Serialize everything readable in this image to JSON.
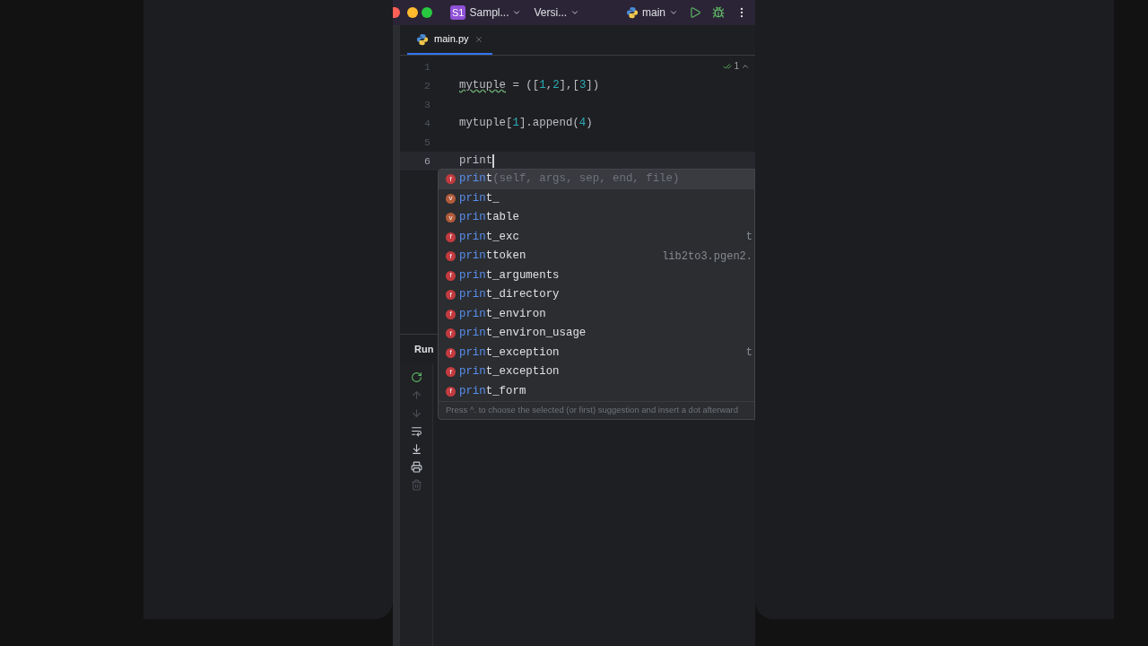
{
  "title_bar": {
    "project_badge": "S1",
    "project": "Sampl...",
    "vcs": "Versi...",
    "run_config": "main"
  },
  "tabs": [
    {
      "label": "main.py",
      "selected": true
    }
  ],
  "inspection": {
    "count": "1"
  },
  "editor": {
    "lines": [
      {
        "number": "1",
        "current": false,
        "caret": false
      },
      {
        "number": "2",
        "current": false,
        "caret": false,
        "tokens": [
          {
            "text": "mytuple",
            "kind": "warn"
          },
          {
            "text": " = ([",
            "kind": "plain"
          },
          {
            "text": "1",
            "kind": "number"
          },
          {
            "text": ",",
            "kind": "plain"
          },
          {
            "text": "2",
            "kind": "number"
          },
          {
            "text": "],[",
            "kind": "plain"
          },
          {
            "text": "3",
            "kind": "number"
          },
          {
            "text": "])",
            "kind": "plain"
          }
        ]
      },
      {
        "number": "3",
        "current": false,
        "caret": false
      },
      {
        "number": "4",
        "current": false,
        "caret": false,
        "tokens": [
          {
            "text": "mytuple[",
            "kind": "plain"
          },
          {
            "text": "1",
            "kind": "number"
          },
          {
            "text": "].append(",
            "kind": "plain"
          },
          {
            "text": "4",
            "kind": "number"
          },
          {
            "text": ")",
            "kind": "plain"
          }
        ]
      },
      {
        "number": "5",
        "current": false,
        "caret": false
      },
      {
        "number": "6",
        "current": true,
        "caret": true,
        "tokens": [
          {
            "text": "print",
            "kind": "plain"
          }
        ]
      }
    ]
  },
  "completion": {
    "items": [
      {
        "badge": "f",
        "kind": "function",
        "match": "prin",
        "rest": "t",
        "params": "(self, args, sep, end, file)",
        "selected": true
      },
      {
        "badge": "v",
        "kind": "variable",
        "match": "prin",
        "rest": "t_",
        "selected": false
      },
      {
        "badge": "v",
        "kind": "variable",
        "match": "prin",
        "rest": "table",
        "selected": false
      },
      {
        "badge": "f",
        "kind": "function",
        "match": "prin",
        "rest": "t_exc",
        "detail": "t",
        "selected": false
      },
      {
        "badge": "f",
        "kind": "function",
        "match": "prin",
        "rest": "ttoken",
        "detail": "lib2to3.pgen2.",
        "selected": false
      },
      {
        "badge": "f",
        "kind": "function",
        "match": "prin",
        "rest": "t_arguments",
        "selected": false
      },
      {
        "badge": "f",
        "kind": "function",
        "match": "prin",
        "rest": "t_directory",
        "selected": false
      },
      {
        "badge": "f",
        "kind": "function",
        "match": "prin",
        "rest": "t_environ",
        "selected": false
      },
      {
        "badge": "f",
        "kind": "function",
        "match": "prin",
        "rest": "t_environ_usage",
        "selected": false
      },
      {
        "badge": "f",
        "kind": "function",
        "match": "prin",
        "rest": "t_exception",
        "detail": "t",
        "selected": false
      },
      {
        "badge": "f",
        "kind": "function",
        "match": "prin",
        "rest": "t_exception",
        "selected": false
      },
      {
        "badge": "f",
        "kind": "function",
        "match": "prin",
        "rest": "t_form",
        "selected": false
      }
    ],
    "hint": "Press ^. to choose the selected (or first) suggestion and insert a dot afterward"
  },
  "run_panel": {
    "title": "Run",
    "tools": [
      {
        "kind": "rerun",
        "disabled": false
      },
      {
        "kind": "up",
        "disabled": true
      },
      {
        "kind": "down",
        "disabled": true
      },
      {
        "kind": "wrap",
        "disabled": false
      },
      {
        "kind": "scroll",
        "disabled": false
      },
      {
        "kind": "print",
        "disabled": false
      },
      {
        "kind": "trash",
        "disabled": true
      }
    ]
  }
}
